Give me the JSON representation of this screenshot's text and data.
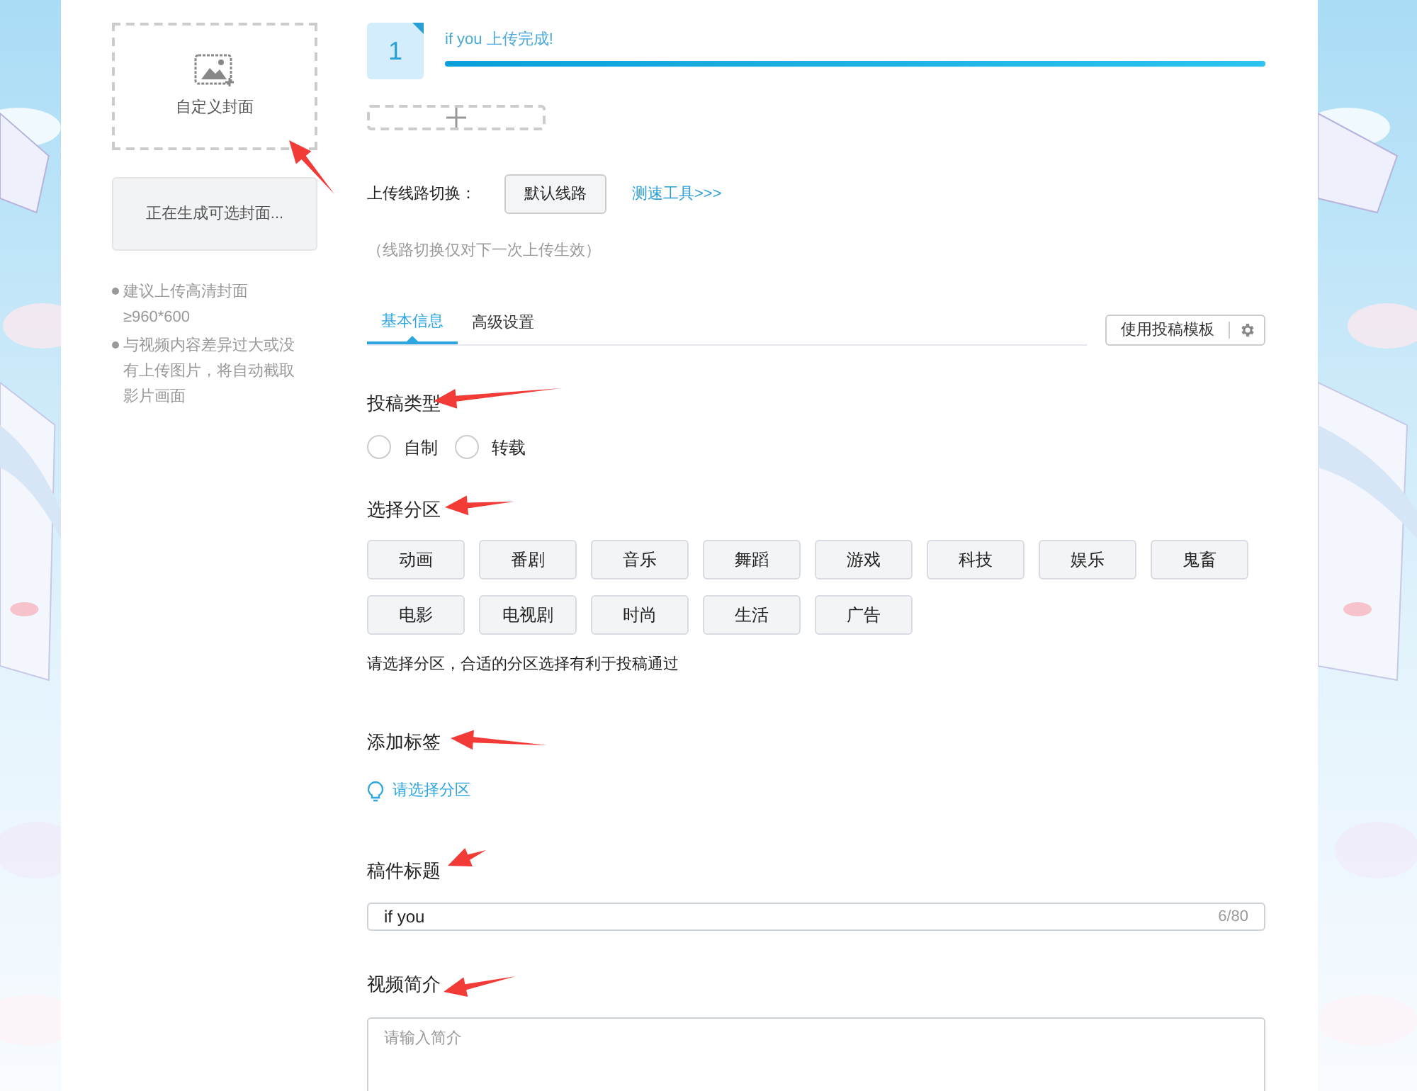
{
  "cover": {
    "label": "自定义封面",
    "generating": "正在生成可选封面...",
    "tips": [
      "建议上传高清封面 ≥960*600",
      "与视频内容差异过大或没有上传图片，将自动截取影片画面"
    ]
  },
  "upload": {
    "index": "1",
    "message": "if you 上传完成!",
    "level": 1
  },
  "route": {
    "label": "上传线路切换：",
    "button": "默认线路",
    "link": "测速工具>>>",
    "note": "（线路切换仅对下一次上传生效）"
  },
  "tabs": [
    {
      "label": "基本信息",
      "selected": true
    },
    {
      "label": "高级设置",
      "selected": false
    }
  ],
  "template_button": "使用投稿模板",
  "type_section": {
    "title": "投稿类型",
    "options": [
      {
        "label": "自制",
        "selected": false
      },
      {
        "label": "转载",
        "selected": false
      }
    ]
  },
  "category_section": {
    "title": "选择分区",
    "categories": [
      {
        "label": "动画",
        "selected": false
      },
      {
        "label": "番剧",
        "selected": false
      },
      {
        "label": "音乐",
        "selected": false
      },
      {
        "label": "舞蹈",
        "selected": false
      },
      {
        "label": "游戏",
        "selected": false
      },
      {
        "label": "科技",
        "selected": false
      },
      {
        "label": "娱乐",
        "selected": false
      },
      {
        "label": "鬼畜",
        "selected": false
      },
      {
        "label": "电影",
        "selected": false
      },
      {
        "label": "电视剧",
        "selected": false
      },
      {
        "label": "时尚",
        "selected": false
      },
      {
        "label": "生活",
        "selected": false
      },
      {
        "label": "广告",
        "selected": false
      }
    ],
    "hint": "请选择分区，合适的分区选择有利于投稿通过"
  },
  "tags_section": {
    "title": "添加标签",
    "hint": "请选择分区"
  },
  "title_section": {
    "title": "稿件标题",
    "value": "if you",
    "count": "6/80"
  },
  "desc_section": {
    "title": "视频简介",
    "placeholder": "请输入简介"
  }
}
